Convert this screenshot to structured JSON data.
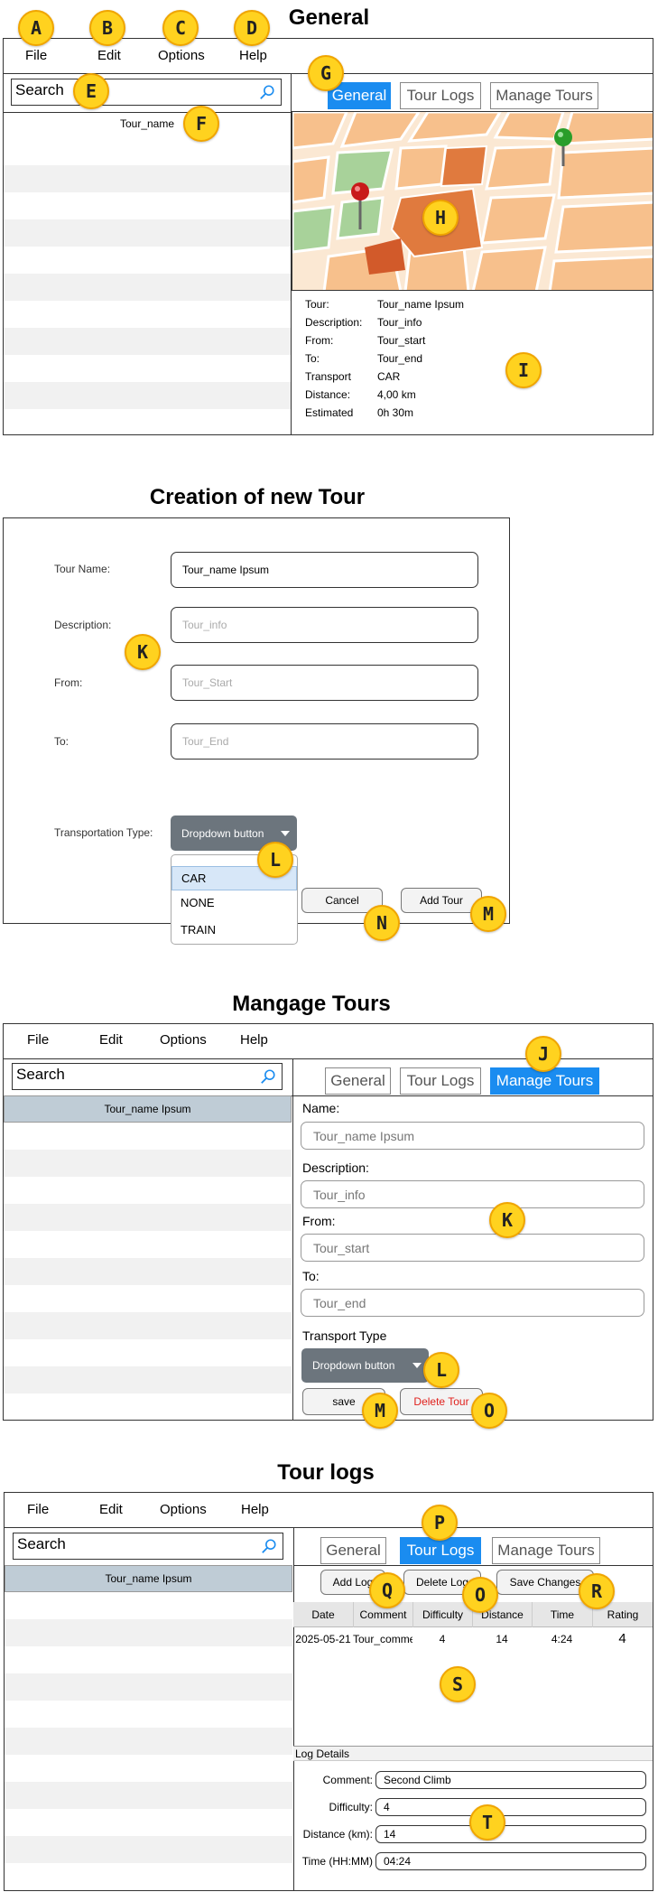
{
  "sections": {
    "general_title": "General",
    "creation_title": "Creation of new Tour",
    "manage_title": "Mangage Tours",
    "logs_title": "Tour logs"
  },
  "menu": {
    "file": "File",
    "edit": "Edit",
    "options": "Options",
    "help": "Help"
  },
  "search": {
    "placeholder": "Search"
  },
  "tabs": {
    "general": "General",
    "tour_logs": "Tour Logs",
    "manage_tours": "Manage Tours"
  },
  "general": {
    "list_item": "Tour_name",
    "info": [
      {
        "label": "Tour:",
        "value": "Tour_name Ipsum"
      },
      {
        "label": "Description:",
        "value": "Tour_info"
      },
      {
        "label": "From:",
        "value": "Tour_start"
      },
      {
        "label": "To:",
        "value": "Tour_end"
      },
      {
        "label": "Transport",
        "value": "CAR"
      },
      {
        "label": "Distance:",
        "value": "4,00 km"
      },
      {
        "label": "Estimated",
        "value": "0h 30m"
      }
    ]
  },
  "creation": {
    "labels": {
      "name": "Tour Name:",
      "description": "Description:",
      "from": "From:",
      "to": "To:",
      "transport": "Transportation Type:"
    },
    "values": {
      "name": "Tour_name Ipsum"
    },
    "placeholders": {
      "description": "Tour_info",
      "from": "Tour_Start",
      "to": "Tour_End"
    },
    "dropdown_label": "Dropdown button",
    "options": [
      "CAR",
      "NONE",
      "TRAIN"
    ],
    "cancel": "Cancel",
    "add": "Add Tour"
  },
  "manage": {
    "list_item": "Tour_name Ipsum",
    "labels": {
      "name": "Name:",
      "description": "Description:",
      "from": "From:",
      "to": "To:",
      "transport": "Transport Type"
    },
    "values": {
      "name": "Tour_name Ipsum",
      "description": "Tour_info",
      "from": "Tour_start",
      "to": "Tour_end"
    },
    "dropdown_label": "Dropdown button",
    "save": "save",
    "delete": "Delete Tour"
  },
  "logs": {
    "list_item": "Tour_name Ipsum",
    "buttons": {
      "add": "Add Log",
      "delete": "Delete Log",
      "save": "Save Changes"
    },
    "columns": [
      "Date",
      "Comment",
      "Difficulty",
      "Distance",
      "Time",
      "Rating"
    ],
    "rows": [
      {
        "date": "2025-05-21",
        "comment": "Tour_commer",
        "difficulty": "4",
        "distance": "14",
        "time": "4:24",
        "rating": "4"
      }
    ],
    "details": {
      "title": "Log Details",
      "comment_label": "Comment:",
      "comment": "Second Climb",
      "difficulty_label": "Difficulty:",
      "difficulty": "4",
      "distance_label": "Distance (km):",
      "distance": "14",
      "time_label": "Time (HH:MM)",
      "time": "04:24"
    }
  },
  "badges": [
    "A",
    "B",
    "C",
    "D",
    "E",
    "F",
    "G",
    "H",
    "I",
    "J",
    "K",
    "L",
    "M",
    "N",
    "O",
    "P",
    "Q",
    "R",
    "S",
    "T"
  ],
  "colors": {
    "active_tab": "#1a8cf0",
    "badge": "#ffd21f",
    "dropdown": "#6c757d",
    "delete_text": "#e0201c",
    "selected_row": "#bfccd6",
    "stripe": "#f1f1f1"
  }
}
